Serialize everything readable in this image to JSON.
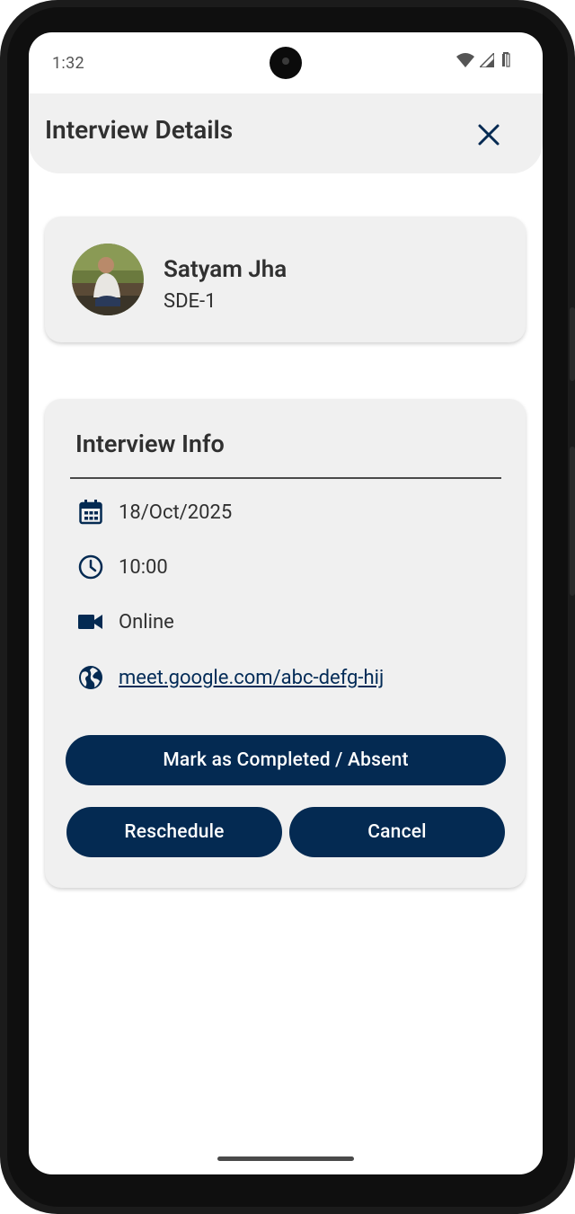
{
  "status_bar": {
    "time": "1:32"
  },
  "app_bar": {
    "title": "Interview Details",
    "close_icon": "close-icon"
  },
  "profile": {
    "name": "Satyam Jha",
    "role": "SDE-1"
  },
  "interview_info": {
    "title": "Interview Info",
    "date": "18/Oct/2025",
    "time": "10:00",
    "mode": "Online",
    "link": "meet.google.com/abc-defg-hij"
  },
  "actions": {
    "complete_label": "Mark as Completed / Absent",
    "reschedule_label": "Reschedule",
    "cancel_label": "Cancel"
  },
  "colors": {
    "primary": "#042a52",
    "card_bg": "#f0f0f0",
    "text": "#303030"
  }
}
